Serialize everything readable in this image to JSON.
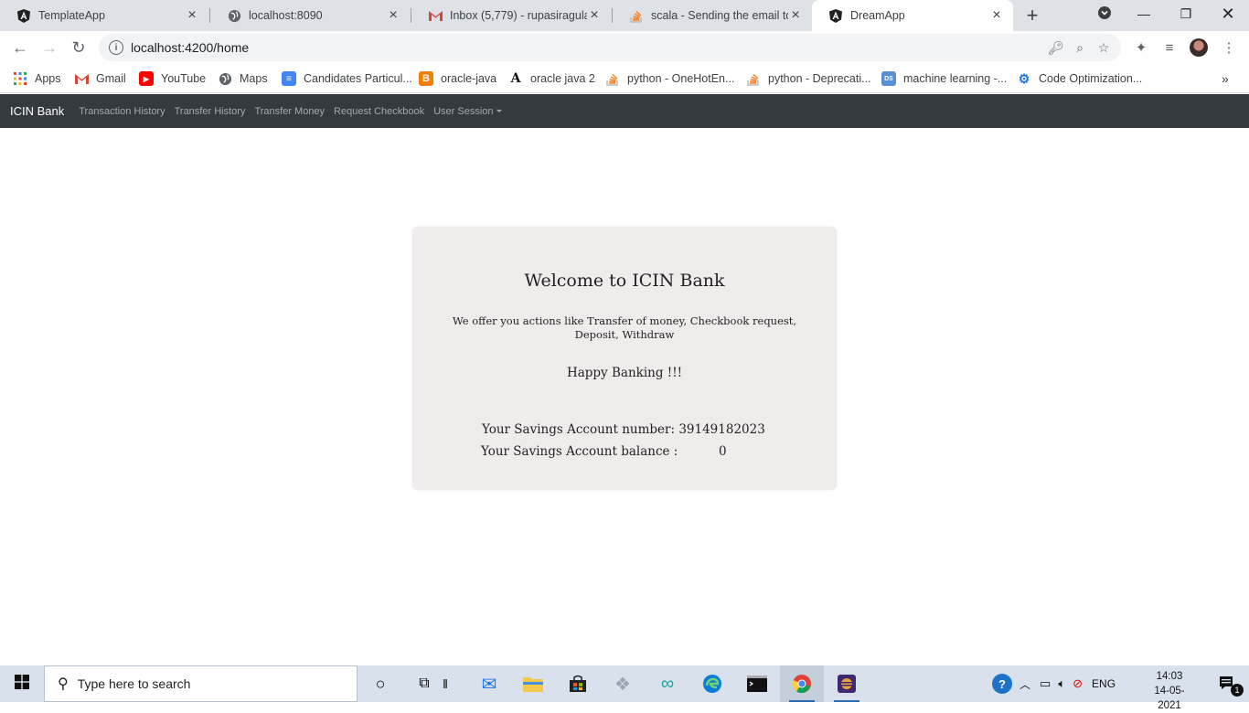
{
  "browser": {
    "tabs": [
      {
        "title": "TemplateApp",
        "icon": "angular-icon"
      },
      {
        "title": "localhost:8090",
        "icon": "globe-icon"
      },
      {
        "title": "Inbox (5,779) - rupasiragula@",
        "icon": "gmail-icon"
      },
      {
        "title": "scala - Sending the email to t",
        "icon": "stackoverflow-icon"
      },
      {
        "title": "DreamApp",
        "icon": "angular-icon"
      }
    ],
    "address": "localhost:4200/home",
    "bookmarks": [
      {
        "label": "Apps"
      },
      {
        "label": "Gmail"
      },
      {
        "label": "YouTube"
      },
      {
        "label": "Maps"
      },
      {
        "label": "Candidates Particul..."
      },
      {
        "label": "oracle-java"
      },
      {
        "label": "oracle java 2"
      },
      {
        "label": "python - OneHotEn..."
      },
      {
        "label": "python - Deprecati..."
      },
      {
        "label": "machine learning -..."
      },
      {
        "label": "Code Optimization..."
      }
    ]
  },
  "app": {
    "brand": "ICIN Bank",
    "nav": [
      "Transaction History",
      "Transfer History",
      "Transfer Money",
      "Request Checkbook",
      "User Session"
    ],
    "card": {
      "title": "Welcome to ICIN Bank",
      "offer": "We offer you actions like Transfer of money, Checkbook request, Deposit, Withdraw",
      "happy": "Happy Banking !!!",
      "account_line": "Your Savings Account number: 39149182023",
      "balance_label": "Your Savings Account balance :",
      "balance_value": "0"
    }
  },
  "taskbar": {
    "search_placeholder": "Type here to search",
    "language": "ENG",
    "time": "14:03",
    "date": "14-05-2021",
    "notification_count": "1"
  }
}
